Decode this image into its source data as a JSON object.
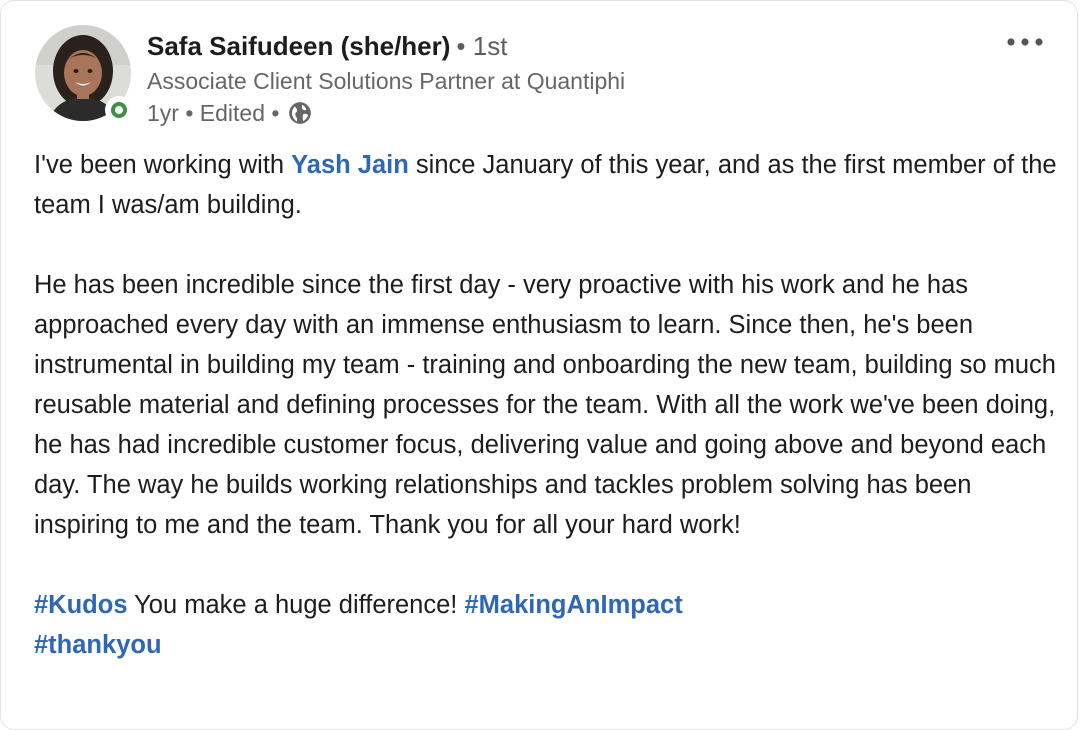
{
  "author": {
    "name": "Safa Saifudeen (she/her)",
    "degree": "• 1st",
    "headline": "Associate Client Solutions Partner at Quantiphi",
    "meta": "1yr • Edited •",
    "presence_color": "#3f8f46"
  },
  "icons": {
    "more": "ellipsis-icon",
    "visibility": "globe-icon"
  },
  "post": {
    "p1_before": "I've been working with ",
    "mention": "Yash Jain",
    "p1_after": " since January of this year, and as the first member of the team I was/am building.",
    "p2": "He has been incredible since the first day - very proactive with his work and he has approached every day with an immense enthusiasm to learn. Since then, he's been instrumental in building my team - training and onboarding the new team, building so much reusable material and defining processes for the team. With all the work we've been doing, he has had incredible customer focus, delivering value and going above and beyond each day. The way he builds working relationships and tackles problem solving has been inspiring to me and the team. Thank you for all your hard work!",
    "hashtag1": "#Kudos",
    "kudos_text": " You make a huge difference! ",
    "hashtag2": "#MakingAnImpact",
    "hashtag3": "#thankyou"
  },
  "colors": {
    "link": "#2f67b8",
    "muted": "#666666"
  }
}
